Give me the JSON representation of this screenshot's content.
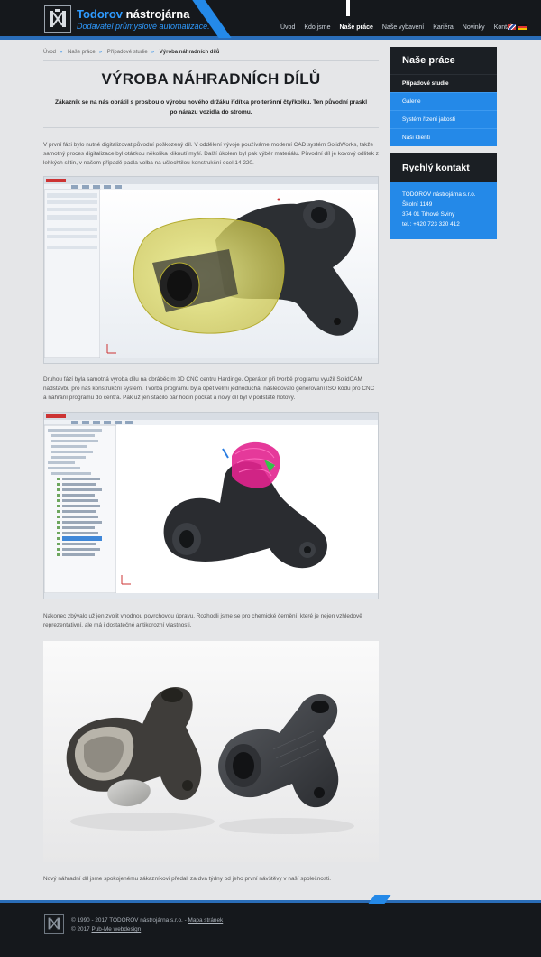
{
  "header": {
    "brand_bold": "Todorov",
    "brand_rest": "nástrojárna",
    "tagline": "Dodavatel průmyslové automatizace.",
    "nav": [
      "Úvod",
      "Kdo jsme",
      "Naše práce",
      "Naše vybavení",
      "Kariéra",
      "Novinky",
      "Kontakt"
    ],
    "nav_active": "Naše práce",
    "languages": [
      "en",
      "de"
    ]
  },
  "breadcrumb": [
    "Úvod",
    "Naše práce",
    "Případové studie",
    "Výroba náhradních dílů"
  ],
  "breadcrumb_sep": "»",
  "main": {
    "title": "VÝROBA NÁHRADNÍCH DÍLŮ",
    "lead": "Zákazník se na nás obrátil s prosbou o výrobu nového držáku řídítka pro terénní čtyřkolku. Ten původní praskl po nárazu vozidla do stromu.",
    "p1": "V první fázi bylo nutné digitalizovat původní poškozený díl. V oddělení vývoje používáme moderní CAD systém SolidWorks, takže samotný proces digitalizace byl otázkou několika kliknutí myší. Další úkolem byl pak výběr materiálu. Původní díl je kovový odlitek z lehkých slitin, v našem případě padla volba na ušlechtilou konstrukční ocel 14 220.",
    "p2": "Druhou fází byla samotná výroba dílu na obráběcím 3D CNC centru Hardinge. Operátor při tvorbě programu využil SolidCAM nadstavbu pro náš konstrukční systém. Tvorba programu byla opět velmi jednoduchá, následovalo generování ISO kódu pro CNC a nahrání programu do centra. Pak už jen stačilo pár hodin počkat a nový díl byl v podstatě hotový.",
    "p3": "Nakonec zbývalo už jen zvolit vhodnou povrchovou úpravu. Rozhodli jsme se pro chemické černění, které je nejen vzhledově reprezentativní, ale má i dostatečné antikorozní vlastnosti.",
    "p4": "Nový náhradní díl jsme spokojenému zákazníkovi předali za dva týdny od jeho první návštěvy v naší společnosti."
  },
  "sidebar": {
    "works_title": "Naše práce",
    "items": [
      "Případové studie",
      "Galerie",
      "Systém řízení jakosti",
      "Naši klienti"
    ],
    "active_item": "Případové studie",
    "contact_title": "Rychlý kontakt",
    "contact_lines": [
      "TODOROV nástrojárna s.r.o.",
      "Školní 1149",
      "374 01 Trhové Sviny",
      "tel.: +420 723 320 412"
    ]
  },
  "footer": {
    "copyright": "© 1990 - 2017 TODOROV nástrojárna s.r.o. -",
    "sitemap_link": "Mapa stránek",
    "design_prefix": "© 2017",
    "design_link": "Pub-Me webdesign"
  },
  "colors": {
    "accent": "#2489e8",
    "dark": "#1b1f24",
    "background": "#e5e6e8"
  }
}
